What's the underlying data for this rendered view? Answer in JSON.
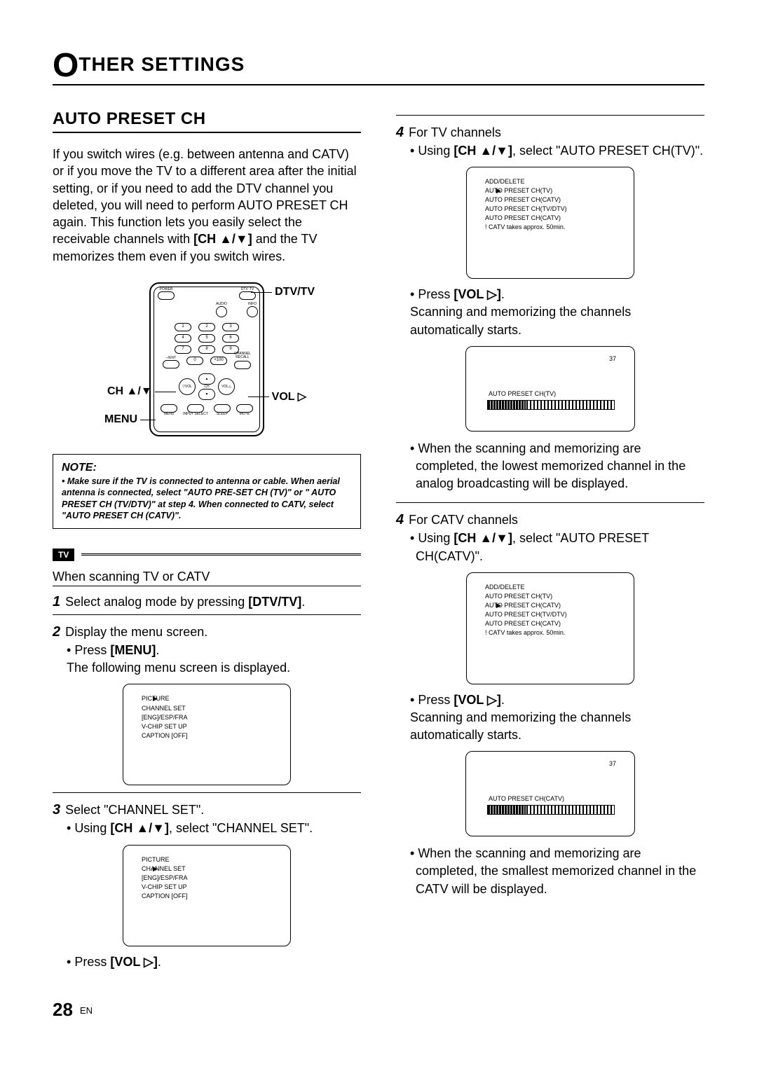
{
  "header": {
    "big_letter": "O",
    "rest": "THER SETTINGS"
  },
  "section_title": "AUTO PRESET CH",
  "intro_parts": {
    "p1": "If you switch wires (e.g. between antenna and CATV) or if you move the TV to a different area after the initial setting, or if you need to add the DTV channel you deleted, you will need to perform AUTO PRESET CH again. This function lets you easily select the receivable channels with ",
    "bold1": "[CH ▲/▼]",
    "p2": " and the TV memorizes them even if you switch wires."
  },
  "callouts": {
    "dtv": "DTV/TV",
    "ch": "CH ▲/▼",
    "menu": "MENU",
    "vol": "VOL ▷"
  },
  "remote_labels": {
    "power": "POWER",
    "dtv": "DTV",
    "tv": "TV",
    "audio": "AUDIO",
    "info": "INFO",
    "ent": "–/ENT",
    "p100": "+100",
    "recall": "CHANNEL RECALL",
    "volL": "▽VOL",
    "volR": "VOL△",
    "chUp": "▲",
    "chDn": "▼",
    "chMid": "CH",
    "menu": "MENU",
    "input": "INPUT SELECT",
    "sleep": "SLEEP",
    "mute": "MUTE"
  },
  "numpad": [
    "1",
    "2",
    "3",
    "4",
    "5",
    "6",
    "7",
    "8",
    "9",
    "",
    "0",
    ""
  ],
  "note": {
    "title": "NOTE:",
    "bullet": "• Make sure if the TV is connected to antenna or cable. When aerial antenna is connected, select \"AUTO PRE-SET CH (TV)\" or \" AUTO PRESET CH (TV/DTV)\" at step 4. When connected to CATV, select \"AUTO PRESET CH (CATV)\"."
  },
  "tv_tag": "TV",
  "when_line": "When scanning TV or CATV",
  "steps_left": {
    "s1": {
      "num": "1",
      "text_before": " Select analog mode by pressing ",
      "bold": "[DTV/TV]",
      "suffix": "."
    },
    "s2": {
      "num": "2",
      "text": " Display the menu screen."
    },
    "s2_sub": {
      "prefix": "Press ",
      "bold": "[MENU]",
      "suffix": "."
    },
    "s2_result": "The following menu screen is displayed.",
    "screen1": {
      "selector_index": 0,
      "items": [
        "PICTURE",
        "CHANNEL SET",
        "[ENG]/ESP/FRA",
        "V-CHIP SET UP",
        "CAPTION [OFF]"
      ]
    },
    "s3": {
      "num": "3",
      "text": " Select \"CHANNEL SET\"."
    },
    "s3_sub": {
      "prefix": "Using ",
      "bold": "[CH ▲/▼]",
      "suffix": ", select \"CHANNEL SET\"."
    },
    "screen2": {
      "selector_index": 1,
      "items": [
        "PICTURE",
        "CHANNEL SET",
        "[ENG]/ESP/FRA",
        "V-CHIP SET UP",
        "CAPTION [OFF]"
      ]
    },
    "s3_press": {
      "prefix": "Press ",
      "bold": "[VOL ▷]",
      "suffix": "."
    }
  },
  "steps_right": {
    "s4a": {
      "num": "4",
      "text": " For TV channels"
    },
    "s4a_sub": {
      "prefix": "Using ",
      "bold": "[CH ▲/▼]",
      "suffix": ", select \"AUTO PRESET CH(TV)\"."
    },
    "screen_tv": {
      "selector_index": 1,
      "items": [
        "ADD/DELETE",
        "AUTO PRESET CH(TV)",
        "AUTO PRESET CH(CATV)",
        "AUTO PRESET CH(TV/DTV)",
        "AUTO PRESET CH(CATV)",
        "! CATV takes approx. 50min."
      ]
    },
    "s4a_press": {
      "prefix": "Press ",
      "bold": "[VOL ▷]",
      "suffix": "."
    },
    "s4a_line": "Scanning and memorizing the channels automatically starts.",
    "scan_tv": {
      "ch": "37",
      "label": "AUTO PRESET CH(TV)",
      "fill_pct": 30
    },
    "s4a_result": "When the scanning and memorizing are completed, the lowest memorized channel in the analog broadcasting will be displayed.",
    "s4b": {
      "num": "4",
      "text": " For CATV channels"
    },
    "s4b_sub": {
      "prefix": "Using ",
      "bold": "[CH ▲/▼]",
      "suffix": ", select \"AUTO PRESET CH(CATV)\"."
    },
    "screen_catv": {
      "selector_index": 2,
      "items": [
        "ADD/DELETE",
        "AUTO PRESET CH(TV)",
        "AUTO PRESET CH(CATV)",
        "AUTO PRESET CH(TV/DTV)",
        "AUTO PRESET CH(CATV)",
        "! CATV takes approx. 50min."
      ]
    },
    "s4b_press": {
      "prefix": "Press ",
      "bold": "[VOL ▷]",
      "suffix": "."
    },
    "s4b_line": "Scanning and memorizing the channels automatically starts.",
    "scan_catv": {
      "ch": "37",
      "label": "AUTO PRESET CH(CATV)",
      "fill_pct": 30
    },
    "s4b_result": "When the scanning and memorizing are completed, the smallest memorized channel in the CATV will be displayed."
  },
  "footer": {
    "page": "28",
    "lang": "EN"
  }
}
